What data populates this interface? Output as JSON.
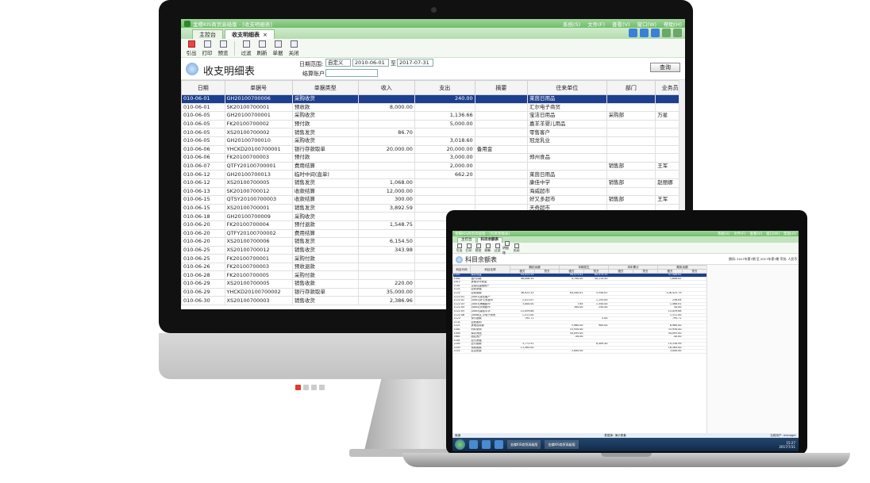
{
  "monitor": {
    "app": {
      "window_title": "金蝶KIS商贸高级版 - [收支明细表]",
      "window_menu": [
        "系统(S)",
        "文件(F)",
        "查看(V)",
        "窗口(W)",
        "帮助(H)"
      ],
      "tabs": [
        {
          "label": "主控台"
        },
        {
          "label": "收支明细表",
          "close": "×"
        }
      ],
      "toolbar": [
        {
          "label": "引出",
          "icon": "export-icon"
        },
        {
          "label": "打印",
          "icon": "print-icon"
        },
        {
          "label": "预览",
          "icon": "preview-icon"
        },
        {
          "label": "过滤",
          "icon": "filter-icon"
        },
        {
          "label": "刷新",
          "icon": "refresh-icon"
        },
        {
          "label": "单据",
          "icon": "document-icon"
        },
        {
          "label": "关闭",
          "icon": "close-door-icon"
        }
      ],
      "report_title": "收支明细表",
      "filter": {
        "date_range_label": "日期范围:",
        "range_mode": "自定义",
        "date_from": "2010-06-01",
        "to_label": "至",
        "date_to": "2017-07-31",
        "account_label": "结算账户:"
      },
      "query_button": "查询",
      "columns": [
        "日期",
        "单据号",
        "单据类型",
        "收入",
        "支出",
        "摘要",
        "往来单位",
        "部门",
        "业务员"
      ],
      "rows": [
        [
          "010-06-01",
          "GH20100700006",
          "采购收货",
          "",
          "240.00",
          "",
          "莱茵日用品",
          "",
          ""
        ],
        [
          "010-06-01",
          "SK20100700001",
          "预收款",
          "8,000.00",
          "",
          "",
          "汇尔电子商贸",
          "",
          ""
        ],
        [
          "010-06-05",
          "GH20100700001",
          "采购收货",
          "",
          "1,136.66",
          "",
          "宝洁日用品",
          "采购部",
          "万星"
        ],
        [
          "010-06-05",
          "FK20100700002",
          "预付款",
          "",
          "5,000.00",
          "",
          "嘉羊羊婴儿用品",
          "",
          ""
        ],
        [
          "010-06-05",
          "XS20100700002",
          "销售发货",
          "86.70",
          "",
          "",
          "零售客户",
          "",
          ""
        ],
        [
          "010-06-05",
          "GH20100700010",
          "采购收货",
          "",
          "3,018.60",
          "",
          "冠龙乳业",
          "",
          ""
        ],
        [
          "010-06-06",
          "YHCKD20100700001",
          "银行存款取单",
          "20,000.00",
          "20,000.00",
          "备用金",
          "",
          "",
          ""
        ],
        [
          "010-06-06",
          "FK20100700003",
          "预付款",
          "",
          "3,000.00",
          "",
          "郑州食品",
          "",
          ""
        ],
        [
          "010-06-07",
          "QTFY20100700001",
          "费用结算",
          "",
          "2,000.00",
          "",
          "",
          "销售部",
          "王军"
        ],
        [
          "010-06-12",
          "GH20100700013",
          "临时中间(直单)",
          "",
          "662.20",
          "",
          "莱茵日用品",
          "",
          ""
        ],
        [
          "010-06-12",
          "XS20100700005",
          "销售发货",
          "1,068.00",
          "",
          "",
          "康佳中学",
          "销售部",
          "赵丽娜"
        ],
        [
          "010-06-13",
          "SK20100700012",
          "收款结算",
          "12,000.00",
          "",
          "",
          "海威超市",
          "",
          ""
        ],
        [
          "010-06-15",
          "QTSY20100700003",
          "收款结算",
          "300.00",
          "",
          "",
          "好又多超市",
          "销售部",
          "王军"
        ],
        [
          "010-06-15",
          "XS20100700001",
          "销售发货",
          "3,892.59",
          "",
          "",
          "天奇超市",
          "",
          ""
        ],
        [
          "010-06-18",
          "GH20100700009",
          "采购收货",
          "",
          "4,219.00",
          "",
          "",
          "",
          ""
        ],
        [
          "010-06-20",
          "FK20100700004",
          "预付退款",
          "1,548.75",
          "",
          "",
          "",
          "",
          ""
        ],
        [
          "010-06-20",
          "QTFY20100700002",
          "费用结算",
          "",
          "100.00",
          "团达万里工厂",
          "",
          "",
          ""
        ],
        [
          "010-06-20",
          "XS20100700006",
          "销售发货",
          "6,154.50",
          "",
          "",
          "",
          "",
          ""
        ],
        [
          "010-06-25",
          "XS20100700012",
          "销售收货",
          "343.98",
          "",
          "",
          "",
          "",
          ""
        ],
        [
          "010-06-25",
          "FK20100700001",
          "采购付款",
          "",
          "25,756.00",
          "",
          "",
          "",
          ""
        ],
        [
          "010-06-26",
          "FK20100700003",
          "预收退款",
          "",
          "755.00",
          "",
          "",
          "",
          ""
        ],
        [
          "010-06-28",
          "FK20100700005",
          "采购付款",
          "",
          "1,280.11",
          "",
          "",
          "",
          ""
        ],
        [
          "010-06-29",
          "XS20100700005",
          "销售收款",
          "220.00",
          "",
          "",
          "",
          "",
          ""
        ],
        [
          "010-06-29",
          "YHCKD20100700002",
          "银行存款取单",
          "35,000.00",
          "35,000.00",
          "转账",
          "",
          "",
          ""
        ],
        [
          "010-06-30",
          "XS20100700003",
          "销售收货",
          "2,386.96",
          "",
          "",
          "",
          "",
          ""
        ]
      ]
    }
  },
  "laptop": {
    "app": {
      "window_title": "金蝶KIS商贸高级版 - [科目余额表]",
      "window_menu": [
        "系统(S)",
        "文件(F)",
        "查看(V)",
        "窗口(W)",
        "帮助(H)"
      ],
      "tabs": [
        {
          "label": "主控台"
        },
        {
          "label": "科目余额表"
        }
      ],
      "toolbar": [
        "引出",
        "打印",
        "预览",
        "刷新",
        "过滤",
        "明细账",
        "关闭"
      ],
      "report_title": "科目余额表",
      "report_info": "期间: 2017年第7期  至  2017年第7期  币别: 人民币",
      "columns": [
        "科目代码",
        "科目名称",
        "期初余额",
        "本期发生",
        "本年累计",
        "期末余额"
      ],
      "sub_columns": [
        "借方",
        "贷方",
        "借方",
        "贷方",
        "借方",
        "贷方",
        "借方",
        "贷方"
      ],
      "rows": [
        [
          "1001",
          "库存现金",
          "54,413.55",
          "",
          "58,475.81",
          "60,474.35",
          "",
          "",
          "57,406.82",
          ""
        ],
        [
          "1002",
          "银行存款",
          "46,006.50",
          "",
          "4,700.00",
          "40,110.00",
          "",
          "",
          "1,606.62",
          ""
        ],
        [
          "1012",
          "其他货币资金",
          "",
          "",
          "",
          "",
          "",
          "",
          "",
          ""
        ],
        [
          "1101",
          "交易性金融资产",
          "",
          "",
          "",
          "",
          "",
          "",
          "",
          ""
        ],
        [
          "1121",
          "应收票据",
          "",
          "",
          "",
          "",
          "",
          "",
          "",
          ""
        ],
        [
          "1122",
          "应收账款",
          "36,925.35",
          "",
          "84,440.81",
          "5,540.81",
          "",
          "",
          "126,425.79",
          ""
        ],
        [
          "1122.01",
          "[0001]零售客户",
          "",
          "",
          "",
          "",
          "",
          "",
          "",
          ""
        ],
        [
          "1122.02",
          "[0002]好又多超市",
          "1,411.07",
          "",
          "",
          "1,154.00",
          "",
          "",
          "256.84",
          ""
        ],
        [
          "1122.03",
          "[0003]海威超市",
          "3,000.00",
          "",
          "7.64",
          "1,540.00",
          "",
          "",
          "1,468.81",
          ""
        ],
        [
          "1122.04",
          "[0004]天奇超市",
          "",
          "",
          "300.00",
          "250.00",
          "",
          "",
          "50.00",
          ""
        ],
        [
          "1122.05",
          "[0005]康佳中学",
          "15,059.68",
          "",
          "",
          "",
          "",
          "",
          "15,059.68",
          ""
        ],
        [
          "1122.06",
          "[0006]汇尔电子商贸",
          "1,511.00",
          "",
          "",
          "",
          "",
          "",
          "1,511.00",
          ""
        ],
        [
          "1123",
          "预付账款",
          "795.71",
          "",
          "",
          "5.00",
          "",
          "",
          "795.71",
          ""
        ],
        [
          "1131",
          "应收股利",
          "",
          "",
          "",
          "",
          "",
          "",
          "",
          ""
        ],
        [
          "1221",
          "其他应收款",
          "",
          "",
          "5,960.00",
          "900.00",
          "",
          "",
          "6,960.00",
          ""
        ],
        [
          "1401",
          "材料采购",
          "",
          "",
          "33,930.00",
          "",
          "",
          "",
          "33,930.00",
          ""
        ],
        [
          "1405",
          "库存商品",
          "",
          "",
          "50,095.00",
          "",
          "",
          "",
          "50,095.00",
          ""
        ],
        [
          "1601",
          "固定资产",
          "",
          "",
          "-40.00",
          "",
          "",
          "",
          "-40.00",
          ""
        ],
        [
          "2201",
          "应付票据",
          "",
          "",
          "",
          "",
          "",
          "",
          "",
          ""
        ],
        [
          "2202",
          "应付账款",
          "3,772.91",
          "",
          "",
          "8,409.40",
          "",
          "",
          "19,538.99",
          ""
        ],
        [
          "2203",
          "预收账款",
          "13,564.00",
          "",
          "",
          "",
          "",
          "",
          "16,564.00",
          ""
        ],
        [
          "2221",
          "应交税费",
          "",
          "",
          "3,000.00",
          "",
          "",
          "",
          "3,000.00",
          ""
        ]
      ],
      "status_left": "就绪",
      "status_mid": "数据库: 演示账套",
      "status_right": "当前用户: manager",
      "taskbar": {
        "window1": "金蝶KIS商贸高级版",
        "window2": "金蝶KIS商贸高级版",
        "time": "15:27",
        "date": "2017/7/31"
      }
    }
  }
}
